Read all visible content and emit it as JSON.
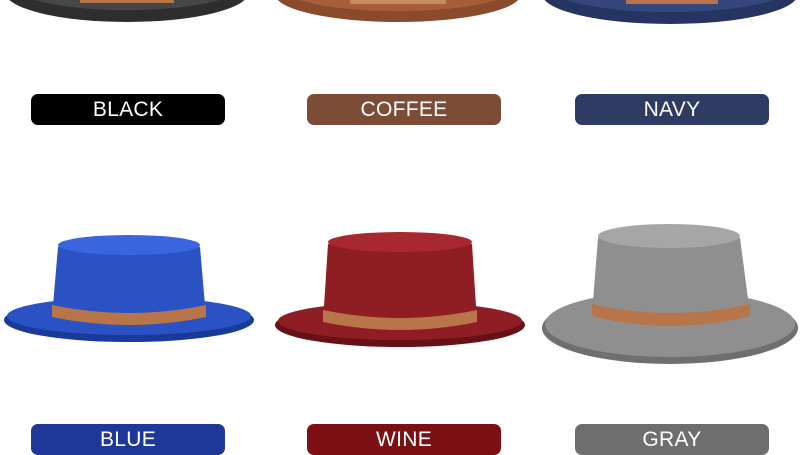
{
  "colors": [
    {
      "label": "BLACK",
      "label_color": "#000000",
      "felt": "#2e2e2e",
      "felt_light": "#474747",
      "felt_dark": "#151515"
    },
    {
      "label": "COFFEE",
      "label_color": "#7d4c36",
      "felt": "#8a4a2c",
      "felt_light": "#a65d3a",
      "felt_dark": "#5e2f19"
    },
    {
      "label": "NAVY",
      "label_color": "#2e3b63",
      "felt": "#253461",
      "felt_light": "#34467c",
      "felt_dark": "#172146"
    },
    {
      "label": "BLUE",
      "label_color": "#1f3796",
      "felt": "#2a52c4",
      "felt_light": "#3966de",
      "felt_dark": "#1a3a99"
    },
    {
      "label": "WINE",
      "label_color": "#7c0f14",
      "felt": "#8f1d24",
      "felt_light": "#a8282f",
      "felt_dark": "#661117"
    },
    {
      "label": "GRAY",
      "label_color": "#6e6e6e",
      "felt": "#8f8f8f",
      "felt_light": "#a6a6a6",
      "felt_dark": "#6f6f6f"
    }
  ],
  "band_color": "#b8754a"
}
